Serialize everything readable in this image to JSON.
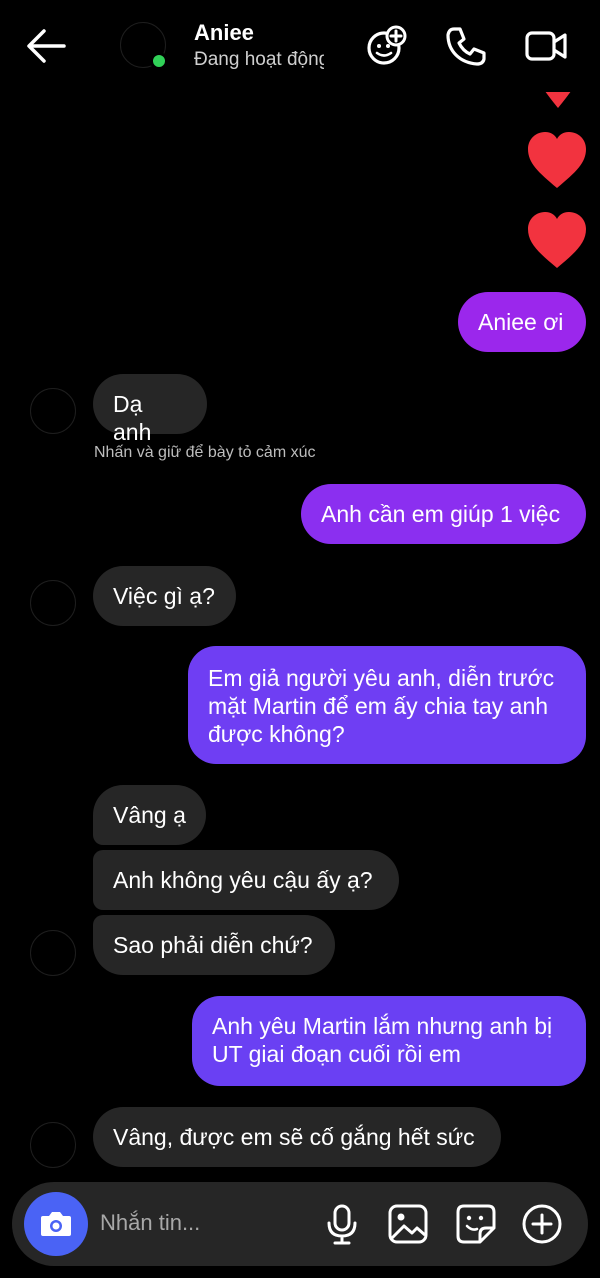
{
  "header": {
    "name": "Aniee",
    "status": "Đang hoạt động",
    "icons": [
      "back-arrow-icon",
      "sticker-add-icon",
      "phone-icon",
      "video-camera-icon"
    ]
  },
  "messages": [
    {
      "id": "m1",
      "direction": "out",
      "text": "Aniee ơi"
    },
    {
      "id": "m2",
      "direction": "in",
      "text": "Dạ anh"
    },
    {
      "id": "m3",
      "direction": "out",
      "text": "Anh cần em giúp 1 việc"
    },
    {
      "id": "m4",
      "direction": "in",
      "text": "Việc gì ạ?"
    },
    {
      "id": "m5",
      "direction": "out",
      "lines": [
        "Em giả người yêu anh, diễn trước",
        "mặt Martin để em ấy chia tay anh",
        "được không?"
      ]
    },
    {
      "id": "m6",
      "direction": "in",
      "text": "Vâng ạ"
    },
    {
      "id": "m7",
      "direction": "in",
      "text": "Anh không yêu cậu ấy ạ?"
    },
    {
      "id": "m8",
      "direction": "in",
      "text": "Sao phải diễn chứ?"
    },
    {
      "id": "m9",
      "direction": "out",
      "lines": [
        "Anh yêu Martin lắm nhưng anh bị",
        "UT giai đoạn cuối rồi em"
      ]
    },
    {
      "id": "m10",
      "direction": "in",
      "text": "Vâng, được em sẽ cố gắng hết sức"
    }
  ],
  "hint": "Nhấn và giữ để bày tỏ cảm xúc",
  "hearts_color": "#f2333f",
  "composer": {
    "placeholder": "Nhắn tin...",
    "icons": [
      "camera-icon",
      "microphone-icon",
      "gallery-icon",
      "sticker-icon",
      "plus-icon"
    ],
    "camera_color": "#4a63f5"
  }
}
